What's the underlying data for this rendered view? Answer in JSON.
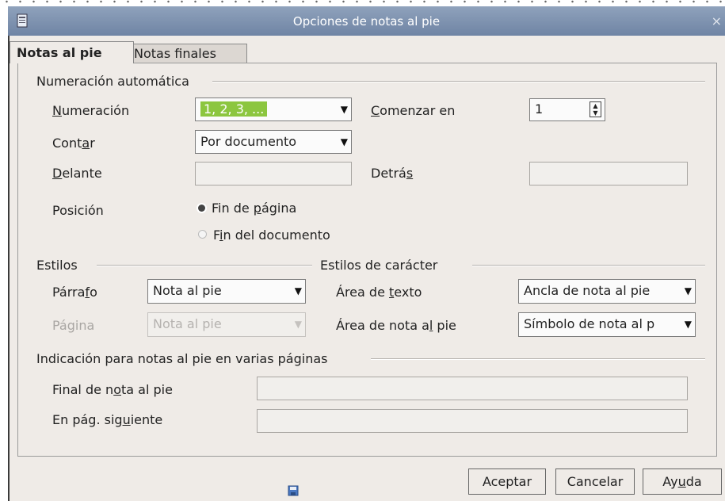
{
  "window": {
    "title": "Opciones de notas al pie",
    "close_glyph": "×",
    "icon": "document-icon"
  },
  "tabs": [
    {
      "label": "Notas al pie",
      "active": true
    },
    {
      "label": "Notas finales",
      "active": false
    }
  ],
  "auto_numbering": {
    "heading": "Numeración automática",
    "numbering": {
      "label": "Numeración",
      "value": "1, 2, 3, ..."
    },
    "start_at": {
      "label": "Comenzar en",
      "value": "1"
    },
    "count": {
      "label": "Contar",
      "value": "Por documento"
    },
    "before": {
      "label": "Delante",
      "value": ""
    },
    "after": {
      "label": "Detrás",
      "value": ""
    },
    "position": {
      "label": "Posición",
      "options": [
        {
          "label": "Fin de página",
          "selected": true
        },
        {
          "label": "Fin del documento",
          "selected": false
        }
      ]
    }
  },
  "styles": {
    "heading": "Estilos",
    "paragraph": {
      "label": "Párrafo",
      "value": "Nota al pie"
    },
    "page": {
      "label": "Página",
      "value": "Nota al pie",
      "disabled": true
    }
  },
  "char_styles": {
    "heading": "Estilos de carácter",
    "text_area": {
      "label": "Área de texto",
      "value": "Ancla de nota al pie"
    },
    "footnote_area": {
      "label": "Área de nota al pie",
      "value": "Símbolo de nota al p"
    }
  },
  "continuation": {
    "heading": "Indicación para notas al pie en varias páginas",
    "end_of_footnote": {
      "label": "Final de nota al pie",
      "value": ""
    },
    "next_page": {
      "label": "En pág. siguiente",
      "value": ""
    }
  },
  "buttons": {
    "ok": "Aceptar",
    "cancel": "Cancelar",
    "help": "Ayuda"
  },
  "colors": {
    "titlebar": "#7f93b0",
    "dialog_bg": "#efebe7",
    "selection": "#8cc63f"
  }
}
